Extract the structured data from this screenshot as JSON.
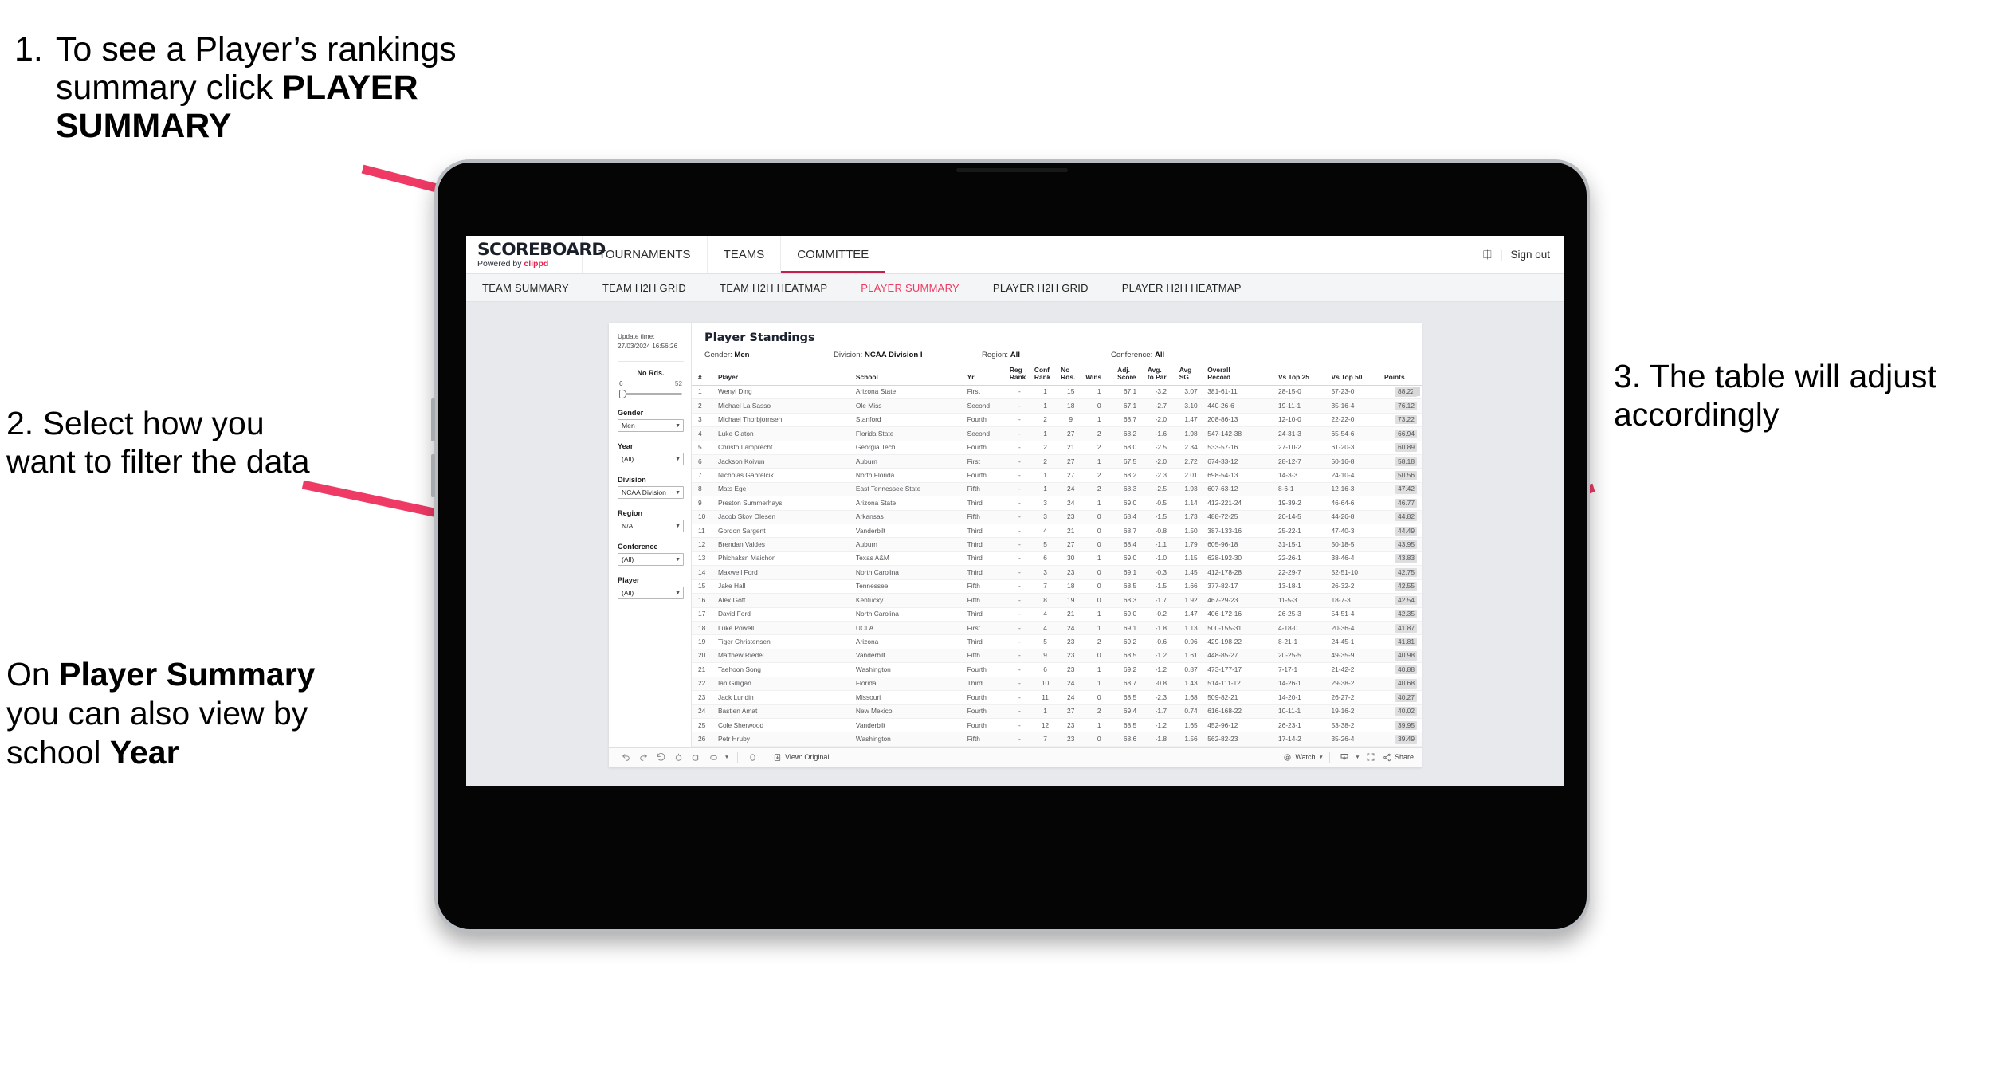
{
  "annotations": {
    "a1": {
      "number": "1.",
      "line1": "To see a Player’s rankings",
      "line2a": "summary click ",
      "line2b": "PLAYER",
      "line3b": "SUMMARY"
    },
    "a2": {
      "text": "2. Select how you want to filter the data"
    },
    "a2b": {
      "pre": "On ",
      "bold1": "Player Summary",
      "mid": " you can also view by school ",
      "bold2": "Year"
    },
    "a3": {
      "text": "3. The table will adjust accordingly"
    },
    "arrow_color": "#ef3a66"
  },
  "app": {
    "logo": {
      "main": "SCOREBOARD",
      "powered_prefix": "Powered by ",
      "powered_brand": "clippd"
    },
    "topnav": [
      {
        "label": "TOURNAMENTS",
        "active": false
      },
      {
        "label": "TEAMS",
        "active": false
      },
      {
        "label": "COMMITTEE",
        "active": true
      }
    ],
    "header_right": {
      "account_icon": "account-icon",
      "divider": "|",
      "signout": "Sign out"
    },
    "subnav": [
      {
        "label": "TEAM SUMMARY",
        "active": false
      },
      {
        "label": "TEAM H2H GRID",
        "active": false
      },
      {
        "label": "TEAM H2H HEATMAP",
        "active": false
      },
      {
        "label": "PLAYER SUMMARY",
        "active": true
      },
      {
        "label": "PLAYER H2H GRID",
        "active": false
      },
      {
        "label": "PLAYER H2H HEATMAP",
        "active": false
      }
    ],
    "accent_color": "#ef3b63",
    "committee_underline_color": "#c4204d"
  },
  "filters": {
    "update_label": "Update time:",
    "update_value": "27/03/2024 16:56:26",
    "slider": {
      "title": "No Rds.",
      "min": "6",
      "max": "52",
      "value": 6
    },
    "groups": [
      {
        "label": "Gender",
        "value": "Men"
      },
      {
        "label": "Year",
        "value": "(All)"
      },
      {
        "label": "Division",
        "value": "NCAA Division I"
      },
      {
        "label": "Region",
        "value": "N/A"
      },
      {
        "label": "Conference",
        "value": "(All)"
      },
      {
        "label": "Player",
        "value": "(All)"
      }
    ]
  },
  "viz": {
    "title": "Player Standings",
    "meta": [
      {
        "label": "Gender: ",
        "value": "Men"
      },
      {
        "label": "Division: ",
        "value": "NCAA Division I"
      },
      {
        "label": "Region: ",
        "value": "All"
      },
      {
        "label": "Conference: ",
        "value": "All"
      }
    ],
    "toolbar": {
      "undo": "undo-icon",
      "redo": "redo-icon",
      "revert": "revert-icon",
      "refresh": "refresh-icon",
      "pause": "pause-icon",
      "view_original_label": "View: Original",
      "watch_label": "Watch",
      "share_label": "Share",
      "download_icon": "download-icon",
      "fullscreen_icon": "fullscreen-icon"
    }
  },
  "chart_data": {
    "type": "table",
    "title": "Player Standings",
    "columns": [
      "#",
      "Player",
      "School",
      "Yr",
      "Reg\nRank",
      "Conf\nRank",
      "No\nRds.",
      "Wins",
      "Adj.\nScore",
      "Avg.\nto Par",
      "Avg\nSG",
      "Overall\nRecord",
      "Vs Top 25",
      "Vs Top 50",
      "Points"
    ],
    "rows": [
      [
        "1",
        "Wenyi Ding",
        "Arizona State",
        "First",
        "-",
        "1",
        "15",
        "1",
        "67.1",
        "-3.2",
        "3.07",
        "381-61-11",
        "28-15-0",
        "57-23-0",
        "88.22"
      ],
      [
        "2",
        "Michael La Sasso",
        "Ole Miss",
        "Second",
        "-",
        "1",
        "18",
        "0",
        "67.1",
        "-2.7",
        "3.10",
        "440-26-6",
        "19-11-1",
        "35-16-4",
        "76.12"
      ],
      [
        "3",
        "Michael Thorbjornsen",
        "Stanford",
        "Fourth",
        "-",
        "2",
        "9",
        "1",
        "68.7",
        "-2.0",
        "1.47",
        "208-86-13",
        "12-10-0",
        "22-22-0",
        "73.22"
      ],
      [
        "4",
        "Luke Claton",
        "Florida State",
        "Second",
        "-",
        "1",
        "27",
        "2",
        "68.2",
        "-1.6",
        "1.98",
        "547-142-38",
        "24-31-3",
        "65-54-6",
        "66.94"
      ],
      [
        "5",
        "Christo Lamprecht",
        "Georgia Tech",
        "Fourth",
        "-",
        "2",
        "21",
        "2",
        "68.0",
        "-2.5",
        "2.34",
        "533-57-16",
        "27-10-2",
        "61-20-3",
        "60.89"
      ],
      [
        "6",
        "Jackson Koivun",
        "Auburn",
        "First",
        "-",
        "2",
        "27",
        "1",
        "67.5",
        "-2.0",
        "2.72",
        "674-33-12",
        "28-12-7",
        "50-16-8",
        "58.18"
      ],
      [
        "7",
        "Nicholas Gabrelcik",
        "North Florida",
        "Fourth",
        "-",
        "1",
        "27",
        "2",
        "68.2",
        "-2.3",
        "2.01",
        "698-54-13",
        "14-3-3",
        "24-10-4",
        "50.56"
      ],
      [
        "8",
        "Mats Ege",
        "East Tennessee State",
        "Fifth",
        "-",
        "1",
        "24",
        "2",
        "68.3",
        "-2.5",
        "1.93",
        "607-63-12",
        "8-6-1",
        "12-16-3",
        "47.42"
      ],
      [
        "9",
        "Preston Summerhays",
        "Arizona State",
        "Third",
        "-",
        "3",
        "24",
        "1",
        "69.0",
        "-0.5",
        "1.14",
        "412-221-24",
        "19-39-2",
        "46-64-6",
        "46.77"
      ],
      [
        "10",
        "Jacob Skov Olesen",
        "Arkansas",
        "Fifth",
        "-",
        "3",
        "23",
        "0",
        "68.4",
        "-1.5",
        "1.73",
        "488-72-25",
        "20-14-5",
        "44-26-8",
        "44.82"
      ],
      [
        "11",
        "Gordon Sargent",
        "Vanderbilt",
        "Third",
        "-",
        "4",
        "21",
        "0",
        "68.7",
        "-0.8",
        "1.50",
        "387-133-16",
        "25-22-1",
        "47-40-3",
        "44.49"
      ],
      [
        "12",
        "Brendan Valdes",
        "Auburn",
        "Third",
        "-",
        "5",
        "27",
        "0",
        "68.4",
        "-1.1",
        "1.79",
        "605-96-18",
        "31-15-1",
        "50-18-5",
        "43.95"
      ],
      [
        "13",
        "Phichaksn Maichon",
        "Texas A&M",
        "Third",
        "-",
        "6",
        "30",
        "1",
        "69.0",
        "-1.0",
        "1.15",
        "628-192-30",
        "22-26-1",
        "38-46-4",
        "43.83"
      ],
      [
        "14",
        "Maxwell Ford",
        "North Carolina",
        "Third",
        "-",
        "3",
        "23",
        "0",
        "69.1",
        "-0.3",
        "1.45",
        "412-178-28",
        "22-29-7",
        "52-51-10",
        "42.75"
      ],
      [
        "15",
        "Jake Hall",
        "Tennessee",
        "Fifth",
        "-",
        "7",
        "18",
        "0",
        "68.5",
        "-1.5",
        "1.66",
        "377-82-17",
        "13-18-1",
        "26-32-2",
        "42.55"
      ],
      [
        "16",
        "Alex Goff",
        "Kentucky",
        "Fifth",
        "-",
        "8",
        "19",
        "0",
        "68.3",
        "-1.7",
        "1.92",
        "467-29-23",
        "11-5-3",
        "18-7-3",
        "42.54"
      ],
      [
        "17",
        "David Ford",
        "North Carolina",
        "Third",
        "-",
        "4",
        "21",
        "1",
        "69.0",
        "-0.2",
        "1.47",
        "406-172-16",
        "26-25-3",
        "54-51-4",
        "42.35"
      ],
      [
        "18",
        "Luke Powell",
        "UCLA",
        "First",
        "-",
        "4",
        "24",
        "1",
        "69.1",
        "-1.8",
        "1.13",
        "500-155-31",
        "4-18-0",
        "20-36-4",
        "41.87"
      ],
      [
        "19",
        "Tiger Christensen",
        "Arizona",
        "Third",
        "-",
        "5",
        "23",
        "2",
        "69.2",
        "-0.6",
        "0.96",
        "429-198-22",
        "8-21-1",
        "24-45-1",
        "41.81"
      ],
      [
        "20",
        "Matthew Riedel",
        "Vanderbilt",
        "Fifth",
        "-",
        "9",
        "23",
        "0",
        "68.5",
        "-1.2",
        "1.61",
        "448-85-27",
        "20-25-5",
        "49-35-9",
        "40.98"
      ],
      [
        "21",
        "Taehoon Song",
        "Washington",
        "Fourth",
        "-",
        "6",
        "23",
        "1",
        "69.2",
        "-1.2",
        "0.87",
        "473-177-17",
        "7-17-1",
        "21-42-2",
        "40.88"
      ],
      [
        "22",
        "Ian Gilligan",
        "Florida",
        "Third",
        "-",
        "10",
        "24",
        "1",
        "68.7",
        "-0.8",
        "1.43",
        "514-111-12",
        "14-26-1",
        "29-38-2",
        "40.68"
      ],
      [
        "23",
        "Jack Lundin",
        "Missouri",
        "Fourth",
        "-",
        "11",
        "24",
        "0",
        "68.5",
        "-2.3",
        "1.68",
        "509-82-21",
        "14-20-1",
        "26-27-2",
        "40.27"
      ],
      [
        "24",
        "Bastien Amat",
        "New Mexico",
        "Fourth",
        "-",
        "1",
        "27",
        "2",
        "69.4",
        "-1.7",
        "0.74",
        "616-168-22",
        "10-11-1",
        "19-16-2",
        "40.02"
      ],
      [
        "25",
        "Cole Sherwood",
        "Vanderbilt",
        "Fourth",
        "-",
        "12",
        "23",
        "1",
        "68.5",
        "-1.2",
        "1.65",
        "452-96-12",
        "26-23-1",
        "53-38-2",
        "39.95"
      ],
      [
        "26",
        "Petr Hruby",
        "Washington",
        "Fifth",
        "-",
        "7",
        "23",
        "0",
        "68.6",
        "-1.8",
        "1.56",
        "562-82-23",
        "17-14-2",
        "35-26-4",
        "39.49"
      ]
    ]
  }
}
